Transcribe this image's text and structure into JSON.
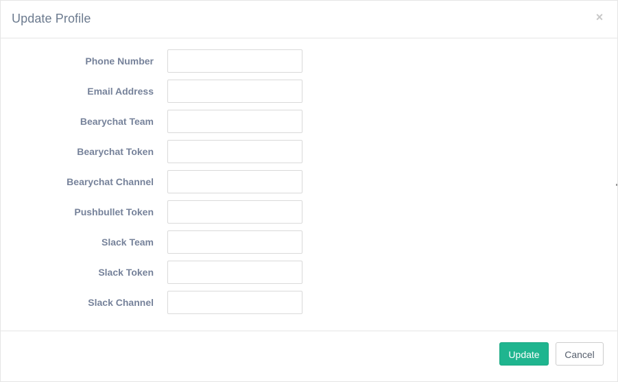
{
  "modal": {
    "title": "Update Profile",
    "close_symbol": "×"
  },
  "form": {
    "fields": [
      {
        "label": "Phone Number",
        "value": "",
        "placeholder": ""
      },
      {
        "label": "Email Address",
        "value": "",
        "placeholder": ""
      },
      {
        "label": "Bearychat Team",
        "value": "",
        "placeholder": ""
      },
      {
        "label": "Bearychat Token",
        "value": "",
        "placeholder": ""
      },
      {
        "label": "Bearychat Channel",
        "value": "",
        "placeholder": ""
      },
      {
        "label": "Pushbullet Token",
        "value": "",
        "placeholder": ""
      },
      {
        "label": "Slack Team",
        "value": "",
        "placeholder": ""
      },
      {
        "label": "Slack Token",
        "value": "",
        "placeholder": ""
      },
      {
        "label": "Slack Channel",
        "value": "",
        "placeholder": ""
      }
    ]
  },
  "footer": {
    "update_label": "Update",
    "cancel_label": "Cancel"
  },
  "colors": {
    "primary": "#1fb58f",
    "title": "#6b7a8e",
    "label": "#76829a",
    "border": "#e5e5e5"
  },
  "icons": {
    "close": "close-icon"
  }
}
